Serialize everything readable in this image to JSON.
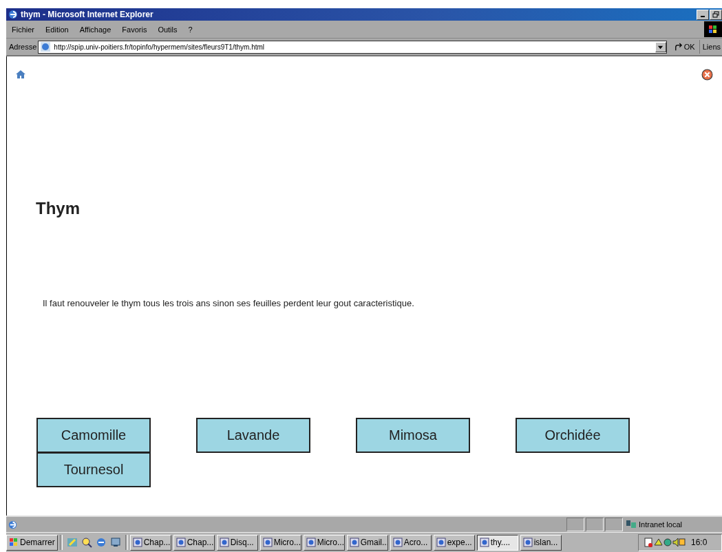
{
  "window": {
    "title": "thym - Microsoft Internet Explorer"
  },
  "menu": [
    "Fichier",
    "Edition",
    "Affichage",
    "Favoris",
    "Outils",
    "?"
  ],
  "address_bar": {
    "label": "Adresse",
    "url": "http://spip.univ-poitiers.fr/topinfo/hypermem/sites/fleurs9T1/thym.html",
    "go": "OK",
    "links": "Liens"
  },
  "page": {
    "title": "Thym",
    "text": "Il faut renouveler le thym tous les trois ans sinon ses feuilles perdent leur gout caracteristique.",
    "buttons": [
      "Camomille",
      "Lavande",
      "Mimosa",
      "Orchidée",
      "Tournesol"
    ]
  },
  "status_bar": {
    "zone": "Intranet local"
  },
  "taskbar": {
    "start": "Demarrer",
    "tasks": [
      {
        "label": "Chap...",
        "selected": false
      },
      {
        "label": "Chap...",
        "selected": false
      },
      {
        "label": "Disq...",
        "selected": false
      },
      {
        "label": "Micro...",
        "selected": false
      },
      {
        "label": "Micro...",
        "selected": false
      },
      {
        "label": "Gmail...",
        "selected": false
      },
      {
        "label": "Acro...",
        "selected": false
      },
      {
        "label": "expe...",
        "selected": false
      },
      {
        "label": "thy....",
        "selected": true
      },
      {
        "label": "islan...",
        "selected": false
      }
    ],
    "clock": "16:0"
  }
}
